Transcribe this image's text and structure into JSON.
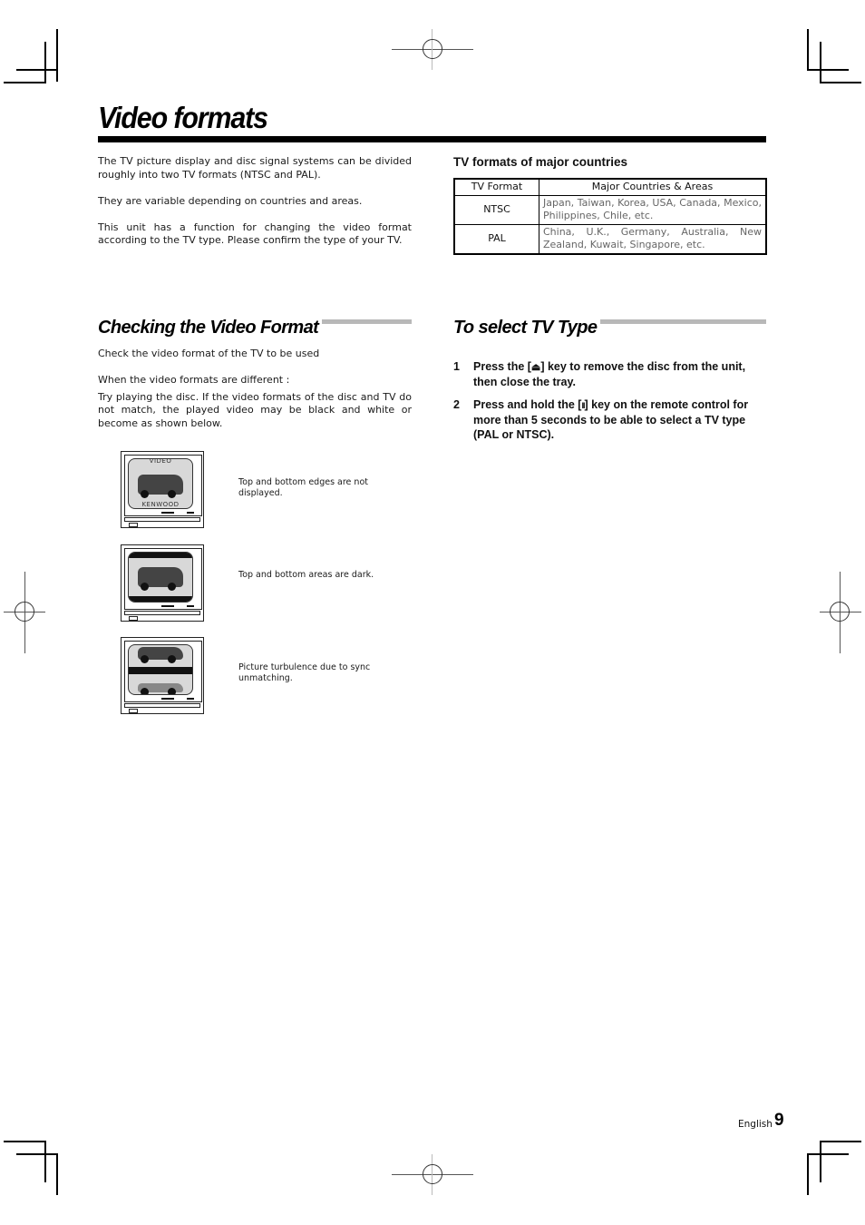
{
  "page": {
    "title": "Video formats",
    "intro_paragraphs": [
      "The TV picture display and disc signal systems can be divided roughly into two TV formats (NTSC and PAL).",
      "They are variable depending on countries and areas.",
      "This unit has a function for changing the video format according to the TV type. Please confirm the type of your TV."
    ],
    "formats_table": {
      "heading": "TV formats of major countries",
      "columns": [
        "TV Format",
        "Major Countries & Areas"
      ],
      "rows": [
        {
          "format": "NTSC",
          "countries": "Japan, Taiwan, Korea, USA, Canada, Mexico, Philippines, Chile, etc."
        },
        {
          "format": "PAL",
          "countries": "China, U.K., Germany, Australia, New Zealand, Kuwait, Singapore, etc."
        }
      ]
    },
    "checking_section": {
      "title": "Checking the Video Format",
      "lead": "Check the video format of the TV to be used",
      "subheading": "When the video formats are different :",
      "body": "Try playing the disc. If the video formats of the disc and TV do not match, the played video may be black and white or become as shown below.",
      "illustrations": [
        {
          "icon": "tv-edges-cut-icon",
          "screen_top_label": "VIDEO",
          "screen_bottom_label": "KENWOOD",
          "caption": "Top and bottom edges are not displayed."
        },
        {
          "icon": "tv-dark-bands-icon",
          "caption": "Top and bottom areas are dark."
        },
        {
          "icon": "tv-sync-turbulence-icon",
          "caption": "Picture turbulence due to sync unmatching."
        }
      ]
    },
    "select_section": {
      "title": "To select TV Type",
      "steps": [
        {
          "number": "1",
          "text_before": "Press the [",
          "key_icon": "eject-icon",
          "key_glyph": "⏏",
          "text_after": "] key to remove the disc from the unit, then close the tray."
        },
        {
          "number": "2",
          "text_before": "Press and hold the [",
          "key_icon": "pause-icon",
          "key_glyph": "II",
          "text_after": "] key on the remote control for more than 5 seconds to be able to select a TV type (PAL or NTSC)."
        }
      ]
    },
    "footer": {
      "language": "English",
      "page_number": "9"
    }
  }
}
